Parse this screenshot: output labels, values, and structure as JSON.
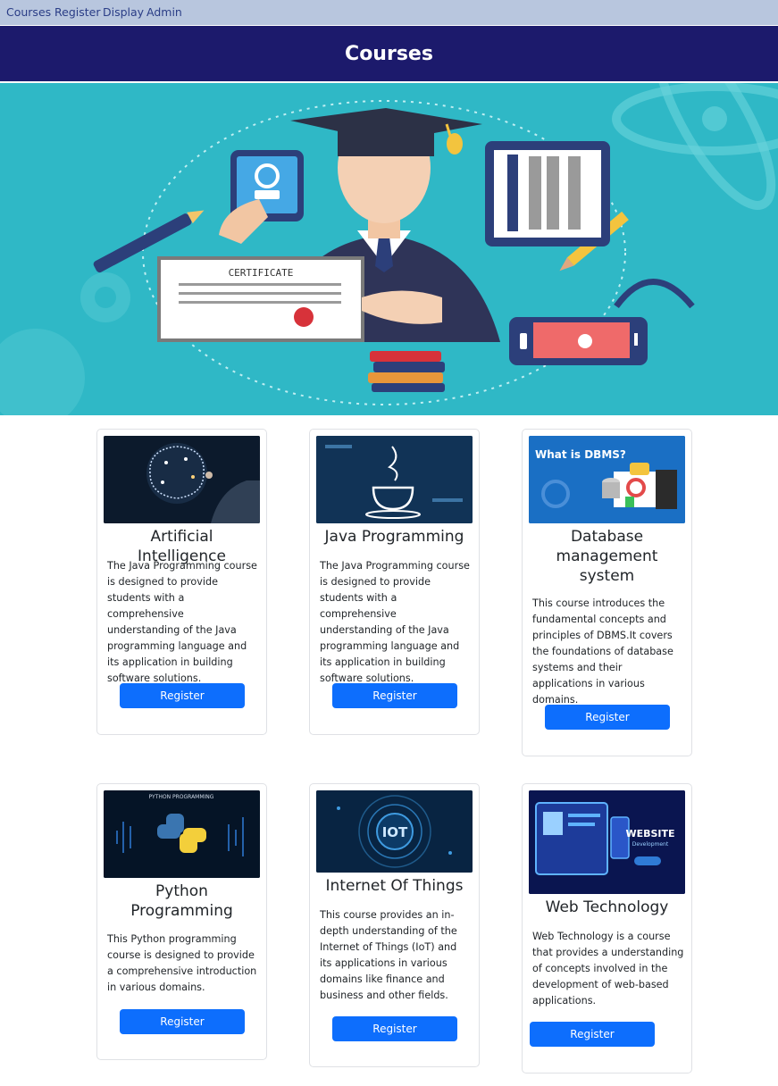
{
  "nav": {
    "items": [
      {
        "label": "Courses"
      },
      {
        "label": "Register"
      },
      {
        "label": "Display"
      },
      {
        "label": "Admin"
      }
    ]
  },
  "header": {
    "title": "Courses"
  },
  "hero": {
    "certificate_text": "CERTIFICATE"
  },
  "courses": [
    {
      "title": "Artificial Intelligence",
      "description": "The Java Programming course is designed to provide students with a comprehensive understanding of the Java programming language and its application in building software solutions.",
      "button": "Register"
    },
    {
      "title": "Java Programming",
      "description": "The Java Programming course is designed to provide students with a comprehensive understanding of the Java programming language and its application in building software solutions.",
      "button": "Register"
    },
    {
      "title": "Database management system",
      "description": "This course introduces the fundamental concepts and principles of DBMS.It covers the foundations of database systems and their applications in various domains.",
      "button": "Register",
      "image_text": "What is DBMS?"
    },
    {
      "title": "Python Programming",
      "description": "This Python programming course is designed to provide a comprehensive introduction in various domains.",
      "button": "Register",
      "image_text": "PYTHON PROGRAMMING"
    },
    {
      "title": "Internet Of Things",
      "description": "This course provides an in-depth understanding of the Internet of Things (IoT) and its applications in various domains like finance and business and other fields.",
      "button": "Register",
      "image_text": "IOT"
    },
    {
      "title": "Web Technology",
      "description": "Web Technology is a course that provides a understanding of concepts involved in the development of web-based applications.",
      "button": "Register",
      "image_text": "WEBSITE",
      "image_subtext": "Development"
    }
  ],
  "colors": {
    "nav_bg": "#b8c6de",
    "header_bg": "#1c1a6c",
    "hero_bg": "#2fb8c6",
    "button_bg": "#0d6efd"
  }
}
